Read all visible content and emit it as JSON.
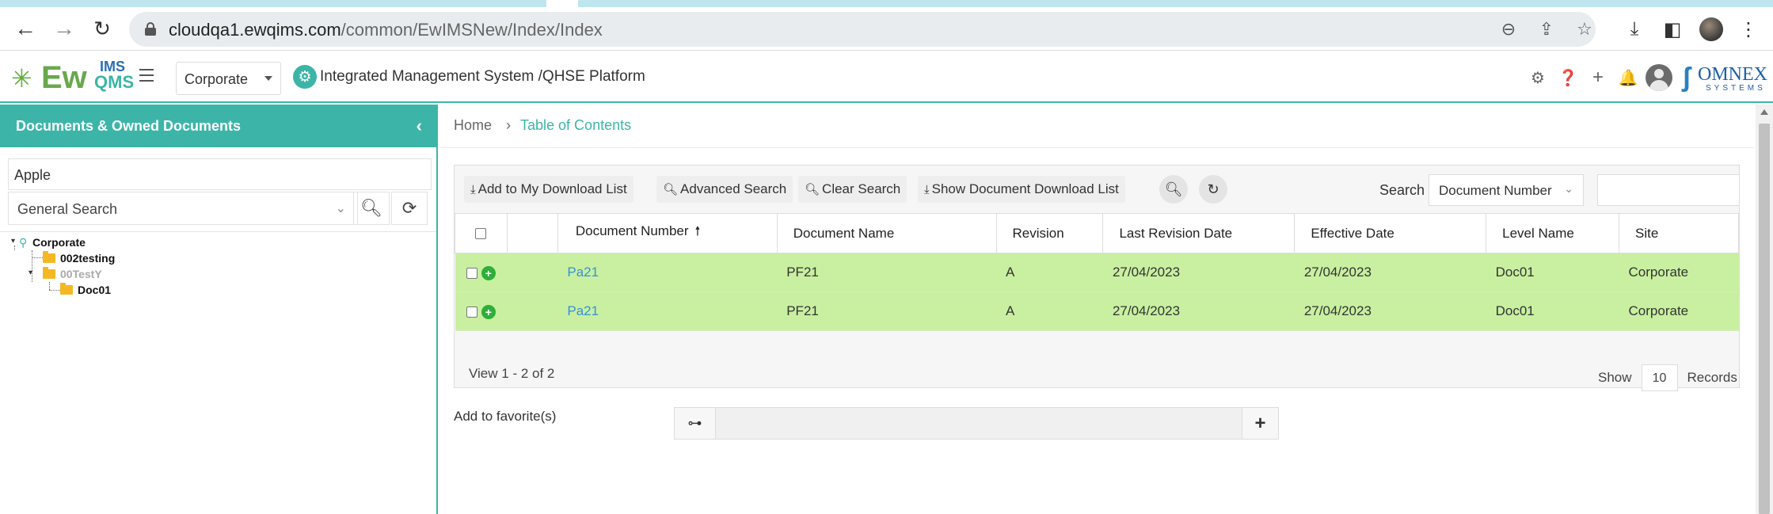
{
  "browser": {
    "url_host": "cloudqa1.ewqims.com",
    "url_path": "/common/EwIMSNew/Index/Index",
    "back_icon": "arrow-left-icon",
    "forward_icon": "arrow-right-icon",
    "reload_icon": "reload-icon"
  },
  "header": {
    "logo": {
      "ew": "Ew",
      "ims": "IMS",
      "qms": "QMS"
    },
    "site_select": "Corporate",
    "platform_title": "Integrated Management System /QHSE Platform",
    "brand": {
      "word": "OMNEX",
      "sub": "SYSTEMS"
    }
  },
  "left_panel": {
    "title": "Documents & Owned Documents",
    "search_value": "Apple",
    "search_mode": "General Search",
    "tree": {
      "root": "Corporate",
      "children": [
        "002testing",
        "00TestY"
      ],
      "grandchild": "Doc01"
    }
  },
  "main": {
    "breadcrumb": {
      "home": "Home",
      "current": "Table of Contents"
    },
    "toolbar": {
      "add_download": "Add to My Download List",
      "advanced_search": "Advanced Search",
      "clear_search": "Clear Search",
      "show_download": "Show Document Download List",
      "search_label": "Search",
      "search_field": "Document Number",
      "search_value": ""
    },
    "table": {
      "columns": [
        "Document Number",
        "Document Name",
        "Revision",
        "Last Revision Date",
        "Effective Date",
        "Level Name",
        "Site"
      ],
      "rows": [
        {
          "number": "Pa21",
          "name": "PF21",
          "revision": "A",
          "last_revision_date": "27/04/2023",
          "effective_date": "27/04/2023",
          "level": "Doc01",
          "site": "Corporate"
        },
        {
          "number": "Pa21",
          "name": "PF21",
          "revision": "A",
          "last_revision_date": "27/04/2023",
          "effective_date": "27/04/2023",
          "level": "Doc01",
          "site": "Corporate"
        }
      ]
    },
    "pager": {
      "view_text": "View 1 - 2 of 2",
      "show_label": "Show",
      "page_size": "10",
      "records_label": "Records"
    },
    "favorites": {
      "label": "Add to favorite(s)"
    }
  },
  "colors": {
    "accent": "#3cb5a8",
    "row_highlight": "#c8f0a0",
    "link": "#3a8fd8"
  }
}
